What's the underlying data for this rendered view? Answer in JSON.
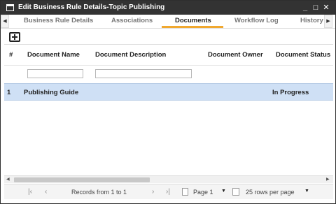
{
  "window": {
    "title": "Edit Business Rule Details-Topic Publishing",
    "minimize_glyph": "_",
    "maximize_glyph": "□",
    "close_glyph": "✕"
  },
  "tabs": {
    "prev_glyph": "◀",
    "next_glyph": "▶",
    "items": [
      {
        "label": "Business Rule Details"
      },
      {
        "label": "Associations"
      },
      {
        "label": "Documents"
      },
      {
        "label": "Workflow Log"
      },
      {
        "label": "History"
      }
    ],
    "active": "Documents",
    "accent_color": "#f0a830"
  },
  "toolbar": {
    "add_icon": "add-square-icon"
  },
  "grid": {
    "columns": [
      "#",
      "Document Name",
      "Document Description",
      "Document Owner",
      "Document Status"
    ],
    "filters": {
      "document_name": "",
      "document_description": ""
    },
    "rows": [
      {
        "num": "1",
        "name": "Publishing Guide",
        "description": "",
        "owner": "",
        "status": "In Progress"
      }
    ],
    "selected_row_color": "#cfe0f5"
  },
  "pager": {
    "first_glyph": "|‹",
    "prev_glyph": "‹",
    "next_glyph": "›",
    "last_glyph": "›|",
    "records_text": "Records from 1 to 1",
    "page_text": "Page 1",
    "page_caret": "▼",
    "rows_per_page_text": "25 rows per page",
    "rows_caret": "▼"
  }
}
